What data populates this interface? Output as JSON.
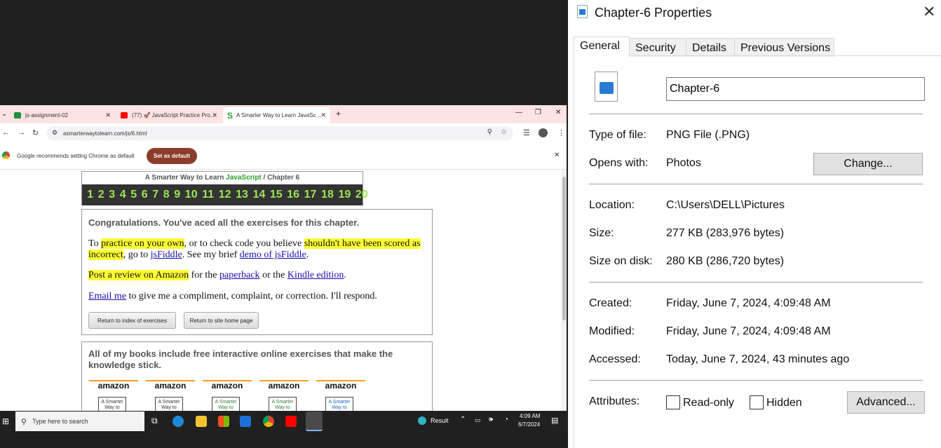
{
  "browser": {
    "tabs": [
      {
        "title": "js-assignment-02",
        "color": "#1e8e3e"
      },
      {
        "title": "(77) 🚀 JavaScript Practice Pro…",
        "color": "#ff0000"
      },
      {
        "title": "A Smarter Way to Learn JavaSc…",
        "color": "#2e9d2e"
      }
    ],
    "new_tab": "+",
    "url": "asmarterwaytolearn.com/js/6.html",
    "infobar_text": "Google recommends setting Chrome as default",
    "set_default_label": "Set as default"
  },
  "page": {
    "header_title_prefix": "A Smarter Way to Learn ",
    "header_title_js": "JavaScript",
    "header_title_suffix": "  /  Chapter 6",
    "chapter_numbers": [
      "1",
      "2",
      "3",
      "4",
      "5",
      "6",
      "7",
      "8",
      "9",
      "10",
      "11",
      "12",
      "13",
      "14",
      "15",
      "16",
      "17",
      "18",
      "19",
      "20"
    ],
    "congrats": "Congratulations. You've aced all the exercises for this chapter.",
    "para1": {
      "to": "To ",
      "practice": "practice on your own",
      "or_check": ", or to check code you believe ",
      "shouldnt": "shouldn't have been scored as incorrect",
      "goto": ", go to ",
      "jsfiddle": "jsFiddle",
      "seemy": ". See my brief ",
      "demo": "demo of jsFiddle",
      "end": "."
    },
    "para2": {
      "review": "Post a review on Amazon",
      "forthe": " for the ",
      "paperback": "paperback",
      "orthe": " or the ",
      "kindle": "Kindle edition",
      "end": "."
    },
    "para3": {
      "email": "Email me",
      "rest": " to give me a compliment, complaint, or correction. I'll respond."
    },
    "btn_index": "Return to index of exercises",
    "btn_home": "Return to site home page",
    "books_heading": "All of my books include free interactive online exercises that make the knowledge stick.",
    "amazon_logo": "amazon",
    "book_cover_text": "A Smarter Way to Learn"
  },
  "taskbar": {
    "search_placeholder": "Type here to search",
    "weather": "Result",
    "time": "4:09 AM",
    "date": "6/7/2024"
  },
  "dialog": {
    "title": "Chapter-6 Properties",
    "tabs": [
      "General",
      "Security",
      "Details",
      "Previous Versions"
    ],
    "file_name": "Chapter-6",
    "type_label": "Type of file:",
    "type_value": "PNG File (.PNG)",
    "opens_label": "Opens with:",
    "opens_value": "Photos",
    "change_button": "Change...",
    "location_label": "Location:",
    "location_value": "C:\\Users\\DELL\\Pictures",
    "size_label": "Size:",
    "size_value": "277 KB (283,976 bytes)",
    "size_disk_label": "Size on disk:",
    "size_disk_value": "280 KB (286,720 bytes)",
    "created_label": "Created:",
    "created_value": "Friday, June 7, 2024, 4:09:48 AM",
    "modified_label": "Modified:",
    "modified_value": "Friday, June 7, 2024, 4:09:48 AM",
    "accessed_label": "Accessed:",
    "accessed_value": "Today, June 7, 2024, 43 minutes ago",
    "attributes_label": "Attributes:",
    "readonly_label": "Read-only",
    "hidden_label": "Hidden",
    "advanced_button": "Advanced..."
  }
}
